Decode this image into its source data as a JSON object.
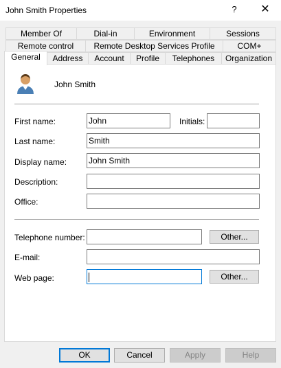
{
  "window": {
    "title": "John Smith Properties",
    "help_glyph": "?",
    "close_glyph": "✕"
  },
  "tabs": {
    "row1": [
      "Member Of",
      "Dial-in",
      "Environment",
      "Sessions"
    ],
    "row2": [
      "Remote control",
      "Remote Desktop Services Profile",
      "COM+"
    ],
    "row3": [
      "General",
      "Address",
      "Account",
      "Profile",
      "Telephones",
      "Organization"
    ],
    "active": "General"
  },
  "general": {
    "display_name": "John Smith",
    "first_name_label": "First name:",
    "first_name": "John",
    "initials_label": "Initials:",
    "initials": "",
    "last_name_label": "Last name:",
    "last_name": "Smith",
    "display_name_label": "Display name:",
    "display_name_value": "John Smith",
    "description_label": "Description:",
    "description": "",
    "office_label": "Office:",
    "office": "",
    "telephone_label": "Telephone number:",
    "telephone": "",
    "email_label": "E-mail:",
    "email": "",
    "webpage_label": "Web page:",
    "webpage": "",
    "other_label": "Other..."
  },
  "buttons": {
    "ok": "OK",
    "cancel": "Cancel",
    "apply": "Apply",
    "help": "Help"
  }
}
